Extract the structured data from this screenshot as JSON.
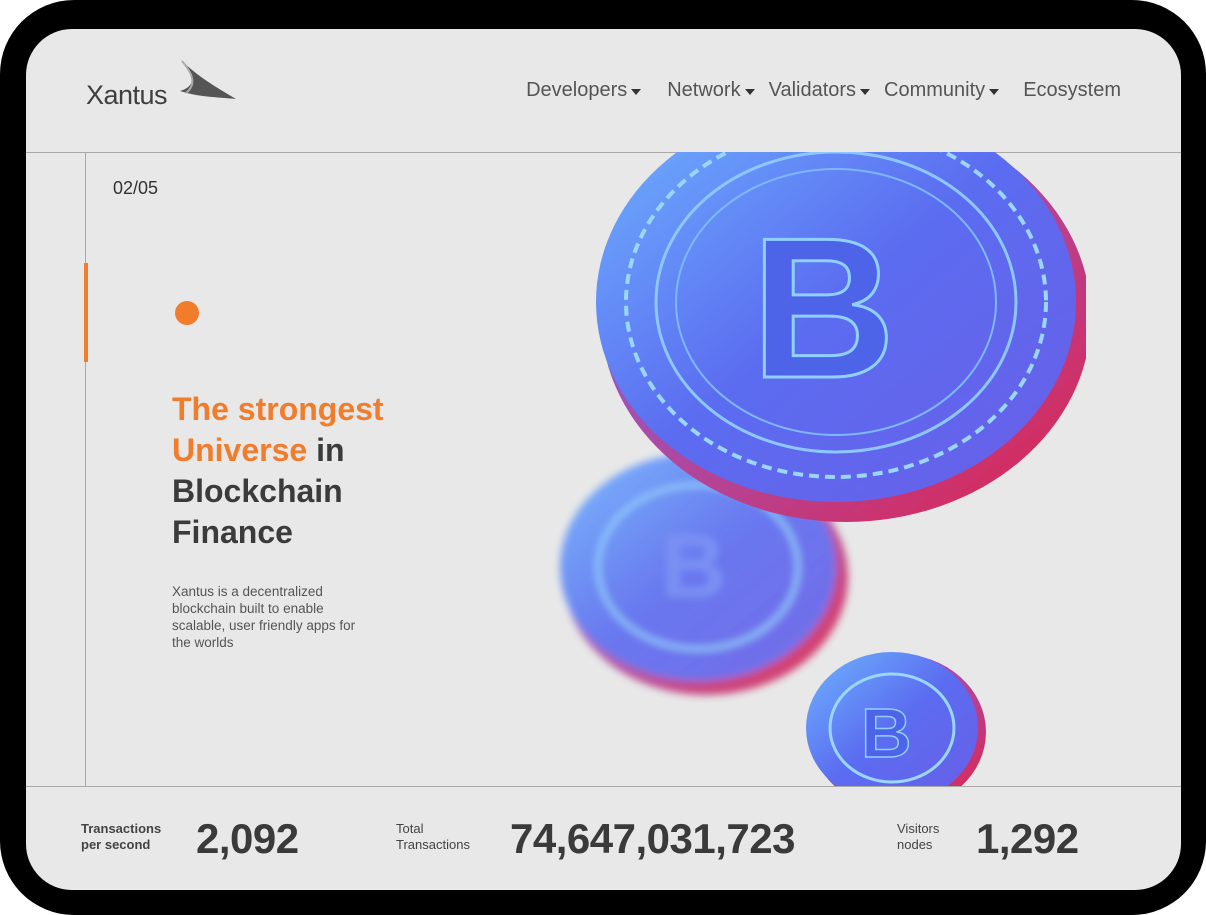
{
  "brand": {
    "name": "Xantus"
  },
  "nav": {
    "items": [
      {
        "label": "Developers",
        "has_dropdown": true
      },
      {
        "label": "Network",
        "has_dropdown": true
      },
      {
        "label": "Validators",
        "has_dropdown": true
      },
      {
        "label": "Community",
        "has_dropdown": true
      },
      {
        "label": "Ecosystem",
        "has_dropdown": false
      }
    ]
  },
  "hero": {
    "slide_counter": "02/05",
    "headline_accent_1": "The strongest",
    "headline_accent_2": "Universe",
    "headline_rest_1": " in",
    "headline_rest_2": "Blockchain",
    "headline_rest_3": "Finance",
    "description": "Xantus is  a decentralized blockchain built to enable scalable, user friendly apps for the worlds",
    "image": "bitcoin-coins-illustration"
  },
  "stats": [
    {
      "label_line1": "Transactions",
      "label_line2": "per second",
      "value": "2,092"
    },
    {
      "label_line1": "Total",
      "label_line2": "Transactions",
      "value": "74,647,031,723"
    },
    {
      "label_line1": "Visitors",
      "label_line2": "nodes",
      "value": "1,292"
    }
  ],
  "colors": {
    "accent": "#f07c2c",
    "background": "#e8e8e8",
    "text": "#3b3b3b",
    "coin": "#5b6cf0"
  }
}
